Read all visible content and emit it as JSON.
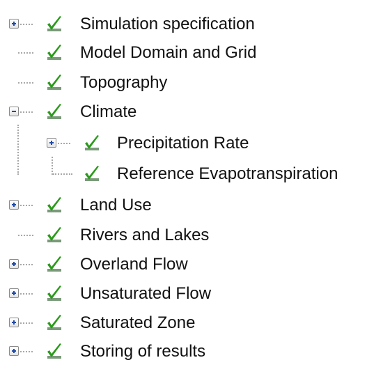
{
  "tree": {
    "check_color": "#2a9a1a",
    "items": [
      {
        "label": "Simulation specification",
        "expander": "plus",
        "icon": "green-check-icon"
      },
      {
        "label": "Model Domain and Grid",
        "expander": "none",
        "icon": "green-check-icon"
      },
      {
        "label": "Topography",
        "expander": "none",
        "icon": "green-check-icon"
      },
      {
        "label": "Climate",
        "expander": "minus",
        "icon": "green-check-icon",
        "children": [
          {
            "label": "Precipitation Rate",
            "expander": "plus",
            "icon": "green-check-icon"
          },
          {
            "label": "Reference Evapotranspiration",
            "expander": "none",
            "icon": "green-check-icon"
          }
        ]
      },
      {
        "label": "Land Use",
        "expander": "plus",
        "icon": "green-check-icon"
      },
      {
        "label": "Rivers and Lakes",
        "expander": "none",
        "icon": "green-check-icon"
      },
      {
        "label": "Overland Flow",
        "expander": "plus",
        "icon": "green-check-icon"
      },
      {
        "label": "Unsaturated Flow",
        "expander": "plus",
        "icon": "green-check-icon"
      },
      {
        "label": "Saturated Zone",
        "expander": "plus",
        "icon": "green-check-icon"
      },
      {
        "label": "Storing of results",
        "expander": "plus",
        "icon": "green-check-icon"
      }
    ]
  }
}
